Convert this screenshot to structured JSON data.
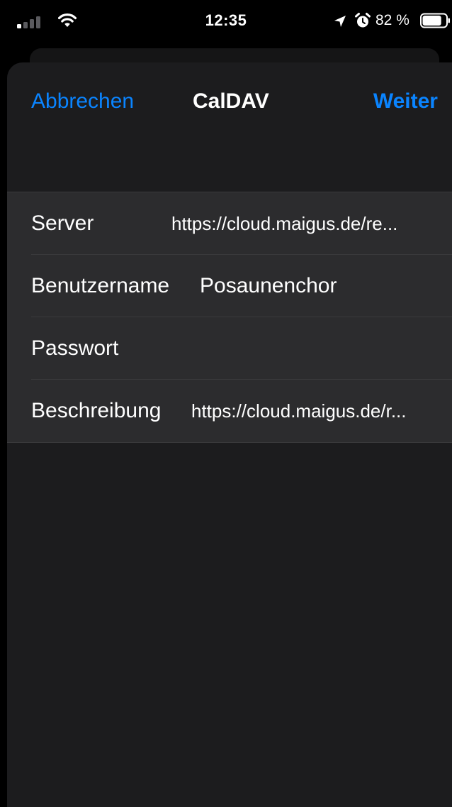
{
  "status_bar": {
    "time": "12:35",
    "battery_percent": "82 %",
    "battery_level": 0.82,
    "signal_bars_active": 1,
    "signal_bars_total": 4,
    "icons": [
      "signal-icon",
      "wifi-icon",
      "location-icon",
      "alarm-icon",
      "battery-icon"
    ]
  },
  "nav": {
    "cancel_label": "Abbrechen",
    "title": "CalDAV",
    "next_label": "Weiter"
  },
  "form": {
    "server": {
      "label": "Server",
      "value": "https://cloud.maigus.de/re..."
    },
    "username": {
      "label": "Benutzername",
      "value": "Posaunenchor"
    },
    "password": {
      "label": "Passwort",
      "value": ""
    },
    "description": {
      "label": "Beschreibung",
      "value": "https://cloud.maigus.de/r..."
    }
  },
  "colors": {
    "accent": "#0a84ff",
    "sheet_background": "#1c1c1e",
    "row_background": "#2c2c2e",
    "separator": "#3a3a3c",
    "text": "#ffffff"
  }
}
